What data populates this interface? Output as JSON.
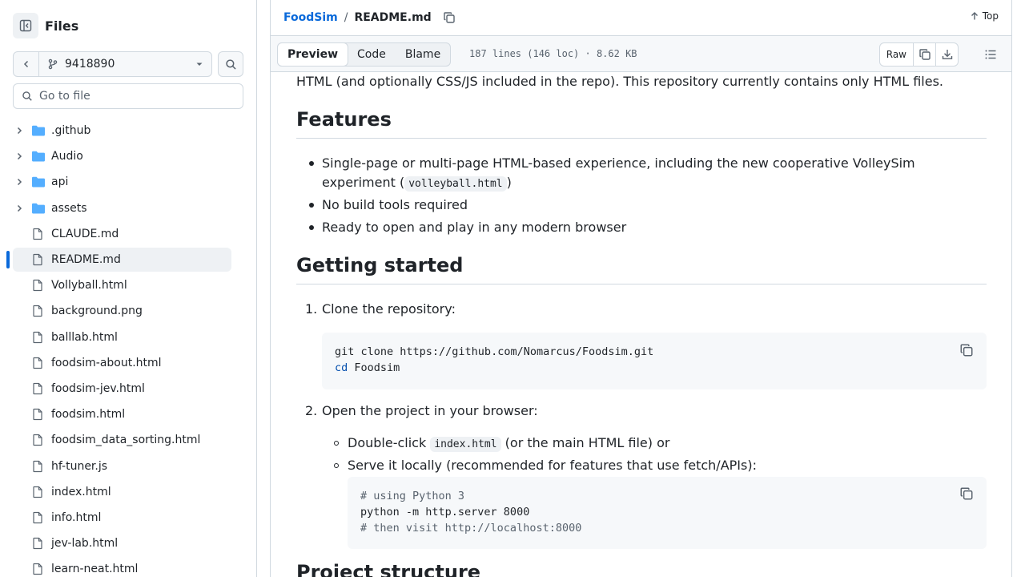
{
  "sidebar": {
    "title": "Files",
    "branch": "9418890",
    "goto_placeholder": "Go to file",
    "items": [
      {
        "label": ".github",
        "type": "folder"
      },
      {
        "label": "Audio",
        "type": "folder"
      },
      {
        "label": "api",
        "type": "folder"
      },
      {
        "label": "assets",
        "type": "folder"
      },
      {
        "label": "CLAUDE.md",
        "type": "file"
      },
      {
        "label": "README.md",
        "type": "file",
        "selected": true
      },
      {
        "label": "Vollyball.html",
        "type": "file"
      },
      {
        "label": "background.png",
        "type": "file"
      },
      {
        "label": "balllab.html",
        "type": "file"
      },
      {
        "label": "foodsim-about.html",
        "type": "file"
      },
      {
        "label": "foodsim-jev.html",
        "type": "file"
      },
      {
        "label": "foodsim.html",
        "type": "file"
      },
      {
        "label": "foodsim_data_sorting.html",
        "type": "file"
      },
      {
        "label": "hf-tuner.js",
        "type": "file"
      },
      {
        "label": "index.html",
        "type": "file"
      },
      {
        "label": "info.html",
        "type": "file"
      },
      {
        "label": "jev-lab.html",
        "type": "file"
      },
      {
        "label": "learn-neat.html",
        "type": "file"
      }
    ]
  },
  "breadcrumb": {
    "repo": "FoodSim",
    "sep": "/",
    "file": "README.md"
  },
  "top_link": "Top",
  "file_header": {
    "tabs": [
      "Preview",
      "Code",
      "Blame"
    ],
    "active_tab": "Preview",
    "meta": "187 lines (146 loc) · 8.62 KB",
    "raw_label": "Raw"
  },
  "readme": {
    "intro": "HTML (and optionally CSS/JS included in the repo). This repository currently contains only HTML files.",
    "features_heading": "Features",
    "feature1_a": "Single-page or multi-page HTML-based experience, including the new cooperative VolleySim",
    "feature1_b": "experiment (",
    "feature1_code": "volleyball.html",
    "feature1_c": ")",
    "feature2": "No build tools required",
    "feature3": "Ready to open and play in any modern browser",
    "getting_started_heading": "Getting started",
    "step1_num": "1.",
    "step1": "Clone the repository:",
    "code1_line1": "git clone https://github.com/Nomarcus/Foodsim.git",
    "code1_kw": "cd",
    "code1_line2_rest": " Foodsim",
    "step2_num": "2.",
    "step2": "Open the project in your browser:",
    "sub1_a": "Double-click ",
    "sub1_code": "index.html",
    "sub1_b": " (or the main HTML file) or",
    "sub2": "Serve it locally (recommended for features that use fetch/APIs):",
    "code2_line1": "# using Python 3",
    "code2_line2": "python -m http.server 8000",
    "code2_line3": "# then visit http://localhost:8000",
    "next_heading": "Project structure"
  }
}
